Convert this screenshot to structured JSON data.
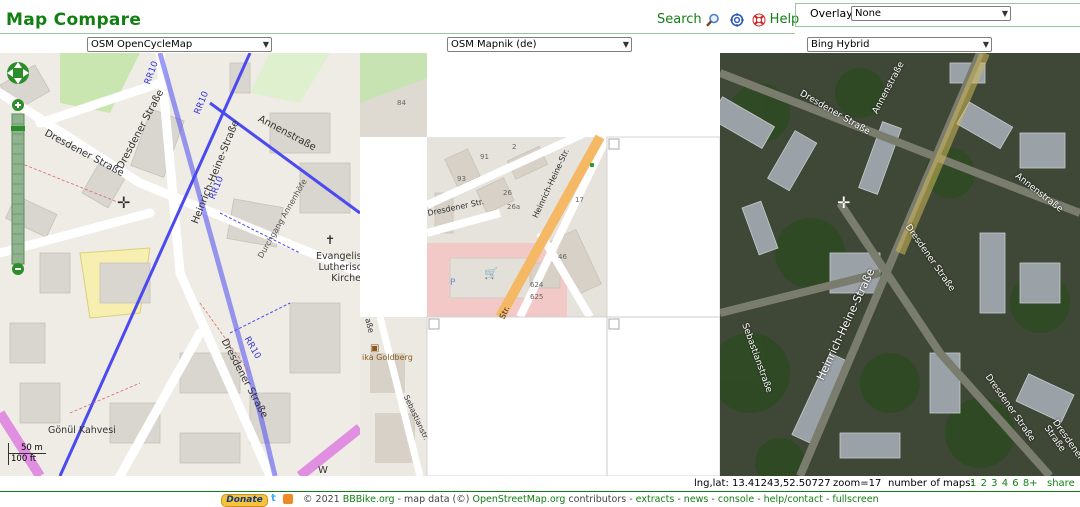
{
  "app": {
    "title": "Map Compare"
  },
  "header": {
    "search_label": "Search",
    "help_label": "Help",
    "overlay_label": "Overlay:",
    "overlay_value": "None"
  },
  "maps": [
    {
      "selector": "OSM OpenCycleMap",
      "labels": {
        "street1": "Dresdener Straße",
        "street2": "Dresdener Straße",
        "street3": "Heinrich-Heine-Straße",
        "street4": "Annenstraße",
        "street5": "Dresdener Straße",
        "route1": "RR10",
        "route2": "RR10",
        "route3": "RR10",
        "route4": "RR10",
        "church1": "Evangelisch-",
        "church2": "Lutherische",
        "church3": "Kirche",
        "path": "Durchgang Annenhöfe",
        "poi": "Gönül Kahvesi",
        "scale_m": "50 m",
        "scale_ft": "100 ft",
        "marker": "W"
      }
    },
    {
      "selector": "OSM Mapnik (de)",
      "labels": {
        "street1": "Dresdener Str.",
        "street2": "Heinrich-Heine-Str.",
        "street3": "Str.",
        "street4": "Sebastianstr.",
        "street5": "aße",
        "poi": "ika Goldberg",
        "p": "P",
        "n1": "91",
        "n2": "93",
        "n3": "26",
        "n4": "26a",
        "n5": "17",
        "n6": "46",
        "n7": "624",
        "n8": "625",
        "n9": "2",
        "n10": "84"
      }
    },
    {
      "selector": "Bing Hybrid",
      "labels": {
        "street1": "Annenstraße",
        "street2": "Annenstraße",
        "street3": "Dresdener Straße",
        "street4": "Dresdener Straße",
        "street5": "Heinrich-Heine-Straße",
        "street6": "Sebastianstraße",
        "street7": "Dresdener Straße",
        "street8": "Dresdener Straße"
      }
    }
  ],
  "status": {
    "coords_label": "lng,lat:",
    "coords_value": "13.41243,52.50727",
    "zoom_label": "zoom=17",
    "num_maps_label": "number of maps:",
    "num_maps": [
      "1",
      "2",
      "3",
      "4",
      "6",
      "8+"
    ],
    "share_label": "share"
  },
  "footer": {
    "donate_label": "Donate",
    "copyright": "© 2021",
    "bbbike_link": "BBBike.org",
    "map_data": " - map data (©)",
    "osm_link": "OpenStreetMap.org",
    "contributors": " contributors - ",
    "links": [
      "extracts",
      "news",
      "console",
      "help/contact",
      "fullscreen"
    ]
  },
  "colors": {
    "brand": "#127f12",
    "cycle_route": "#4a4af0"
  }
}
